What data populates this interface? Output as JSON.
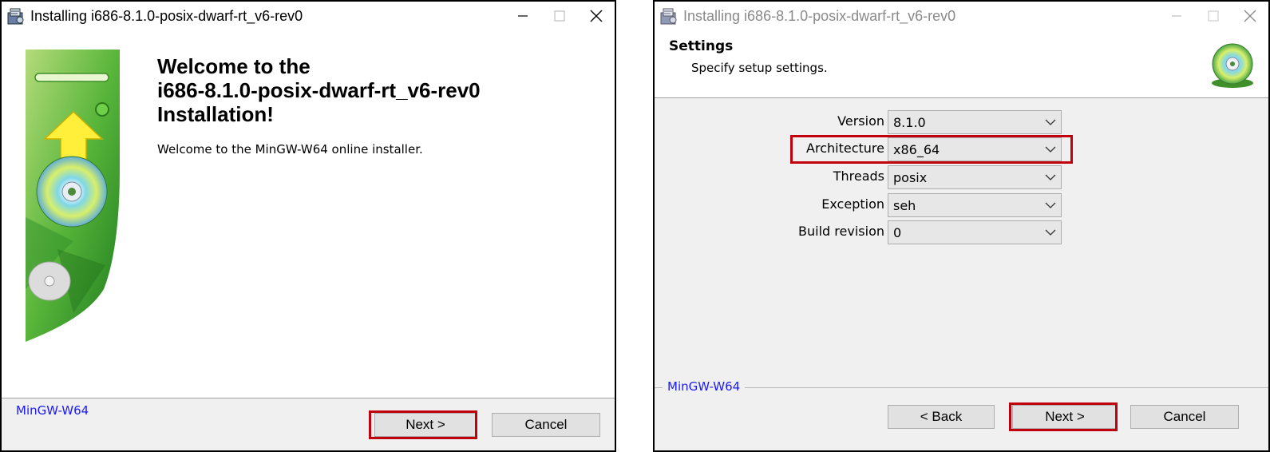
{
  "window1": {
    "title": "Installing i686-8.1.0-posix-dwarf-rt_v6-rev0",
    "heading_lines": [
      "Welcome to the",
      "i686-8.1.0-posix-dwarf-rt_v6-rev0",
      "Installation!"
    ],
    "subtitle": "Welcome to the MinGW-W64 online installer.",
    "brand": "MinGW-W64",
    "next_label": "Next >",
    "cancel_label": "Cancel",
    "highlighted": "next-button"
  },
  "window2": {
    "title": "Installing i686-8.1.0-posix-dwarf-rt_v6-rev0",
    "header_title": "Settings",
    "header_subtitle": "Specify setup settings.",
    "fields": [
      {
        "label": "Version",
        "value": "8.1.0"
      },
      {
        "label": "Architecture",
        "value": "x86_64"
      },
      {
        "label": "Threads",
        "value": "posix"
      },
      {
        "label": "Exception",
        "value": "seh"
      },
      {
        "label": "Build revision",
        "value": "0"
      }
    ],
    "brand": "MinGW-W64",
    "back_label": "< Back",
    "next_label": "Next >",
    "cancel_label": "Cancel",
    "highlighted": [
      "architecture-row",
      "next-button"
    ]
  },
  "colors": {
    "highlight": "#c0000c",
    "brand_text": "#1a1aff",
    "panel_bg": "#f0f0f0",
    "button_bg": "#e1e1e1"
  },
  "icons": [
    "installer-app-icon",
    "minimize-icon",
    "maximize-icon",
    "close-icon",
    "cd-disc-icon",
    "up-arrow-icon",
    "chevron-down-icon"
  ]
}
